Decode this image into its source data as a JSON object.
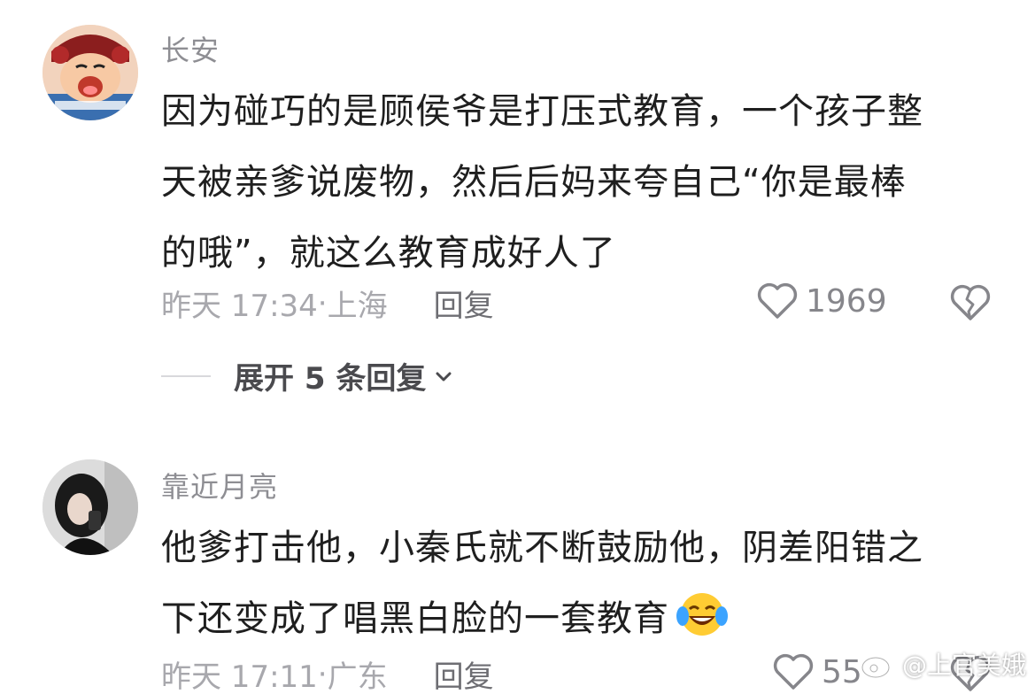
{
  "comments": [
    {
      "username": "长安",
      "text_lines": [
        "因为碰巧的是顾侯爷是打压式教育，一个孩子整",
        "天被亲爹说废物，然后后妈来夸自己“你是最棒",
        "的哦”，就这么教育成好人了"
      ],
      "time": "昨天 17:34",
      "location": "上海",
      "reply_label": "回复",
      "likes": "1969",
      "expand_label": "展开 5 条回复"
    },
    {
      "username": "靠近月亮",
      "text_lines": [
        "他爹打击他，小秦氏就不断鼓励他，阴差阳错之",
        "下还变成了唱黑白脸的一套教育"
      ],
      "time": "昨天 17:11",
      "location": "广东",
      "reply_label": "回复",
      "likes": "55"
    }
  ],
  "separator": "· ",
  "watermark": "@上官美娥",
  "icons": {
    "like": "heart-outline-icon",
    "dislike": "broken-heart-icon",
    "expand": "chevron-down-icon",
    "emoji": "tears-of-joy-emoji",
    "watermark_logo": "weibo-logo-icon"
  },
  "colors": {
    "text": "#1f1f1f",
    "muted": "#a8a8ad",
    "username": "#8e8e93"
  }
}
